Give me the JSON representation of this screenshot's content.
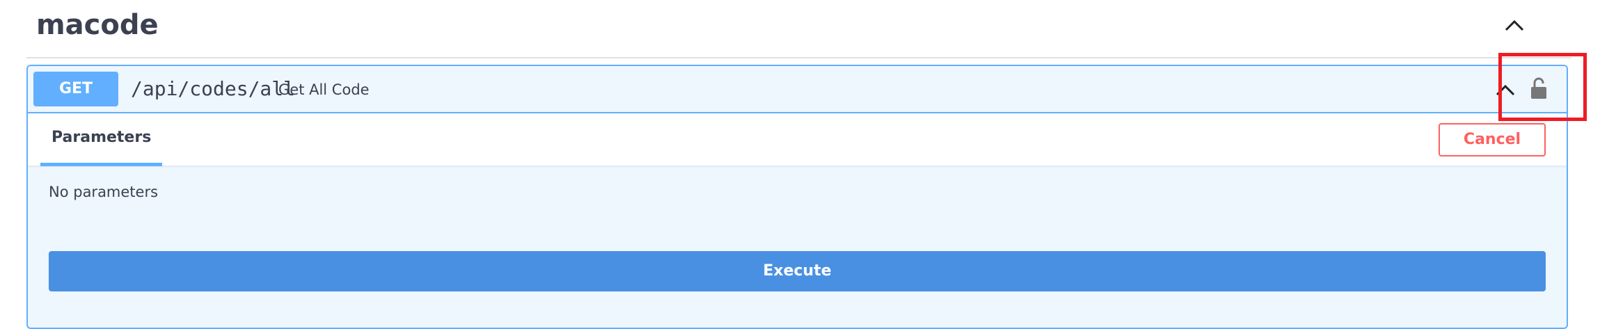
{
  "tag": {
    "title": "macode"
  },
  "operation": {
    "method": "GET",
    "path": "/api/codes/all",
    "summary": "Get All Code",
    "method_color": "#61affe",
    "background_color": "#eef6fe"
  },
  "parameters": {
    "tab_label": "Parameters",
    "cancel_label": "Cancel",
    "empty_text": "No parameters"
  },
  "actions": {
    "execute_label": "Execute",
    "execute_color": "#4990e2",
    "cancel_color": "#ff6060"
  },
  "icons": {
    "tag_toggle": "chevron-up-icon",
    "summary_toggle": "chevron-up-icon",
    "authorization": "unlocked-padlock-icon"
  },
  "highlight": {
    "color": "#ee1c24",
    "target": "authorization-lock-button"
  }
}
